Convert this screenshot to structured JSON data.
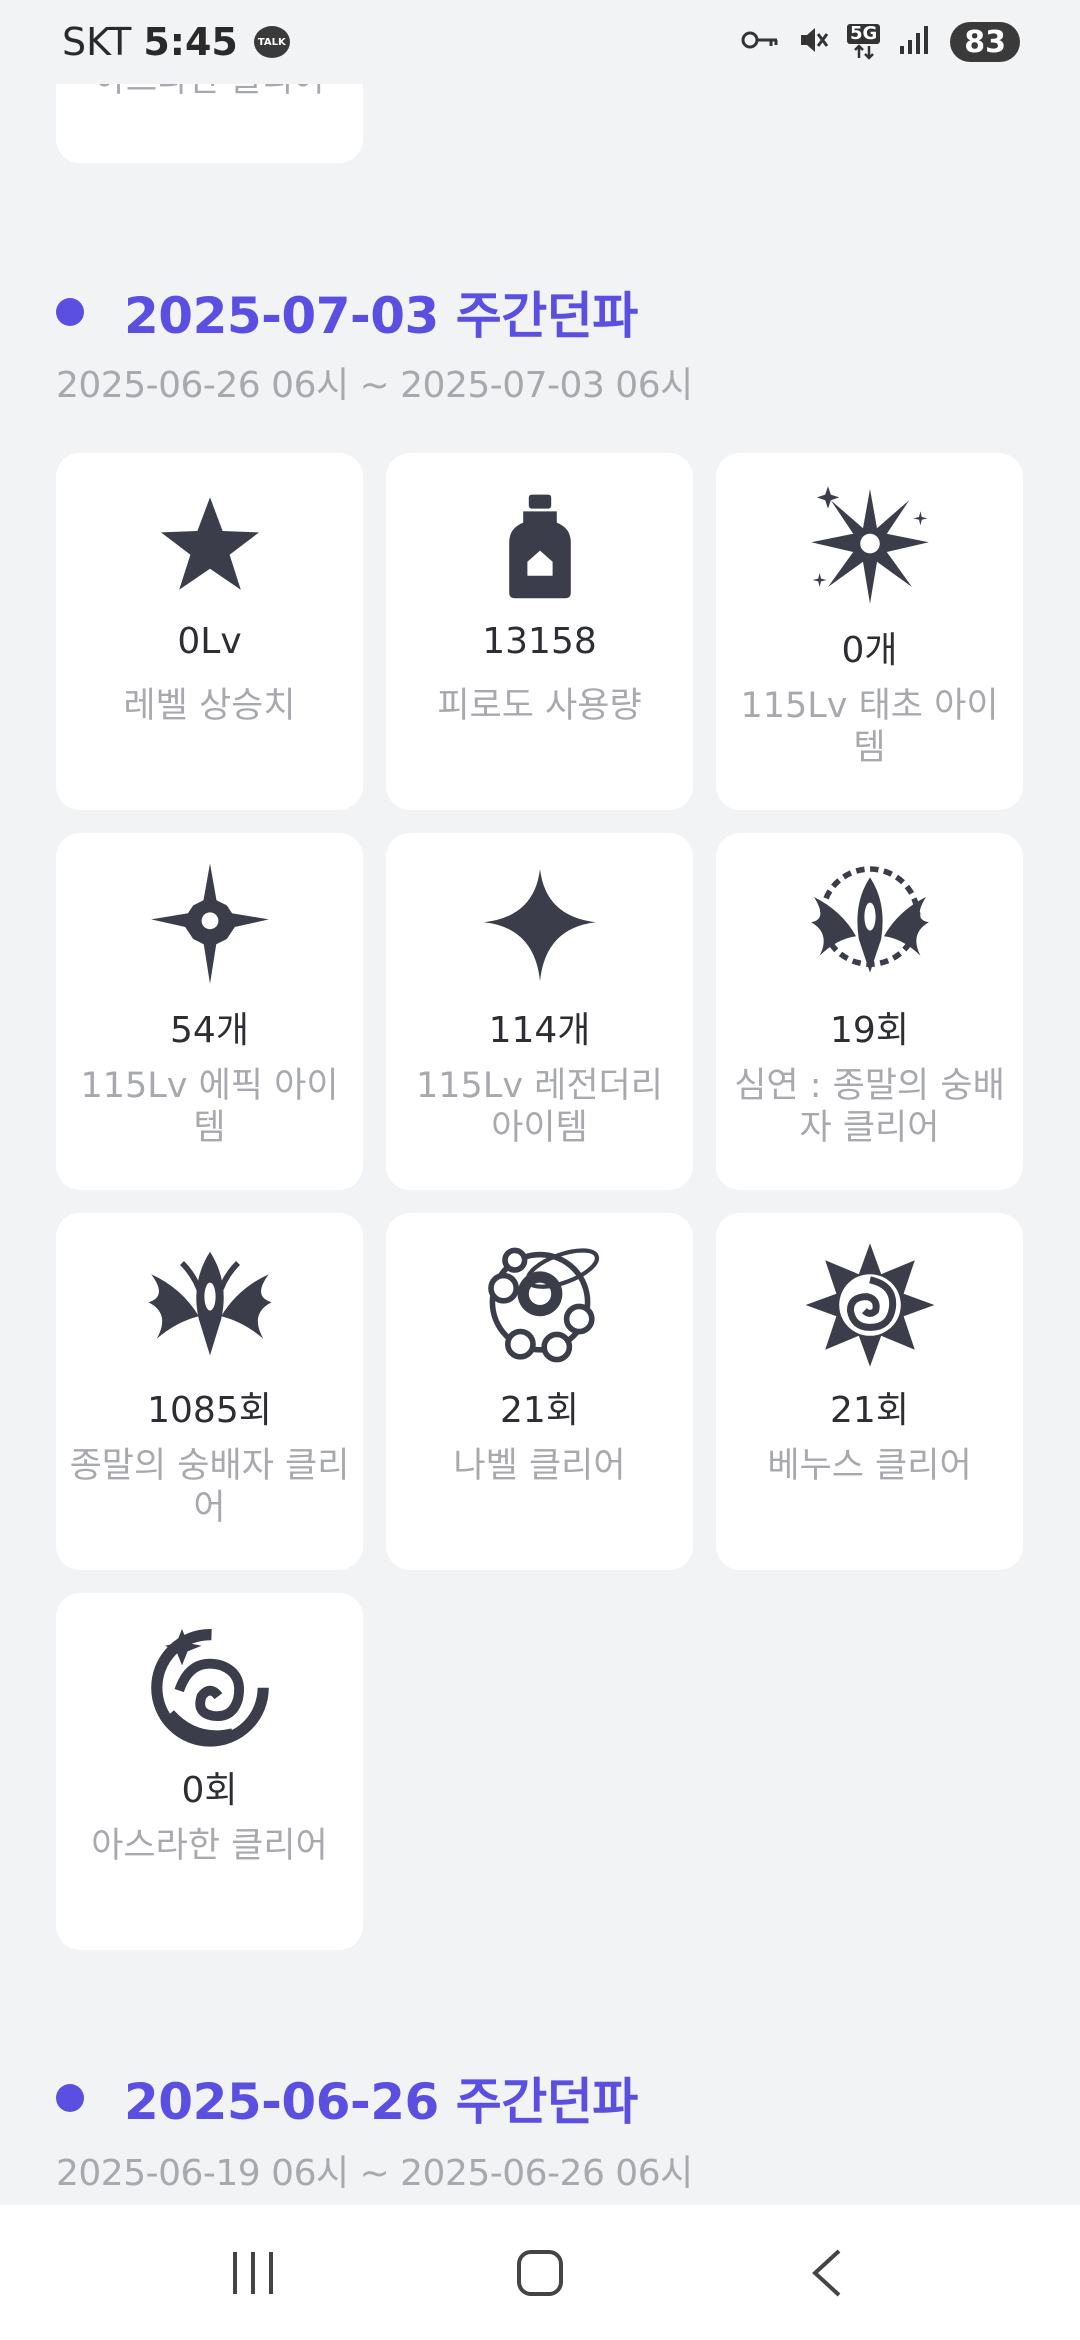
{
  "status_bar": {
    "carrier": "SKT",
    "time": "5:45",
    "talk_badge": "TALK",
    "network": "5G",
    "battery": "83"
  },
  "previous_card": {
    "label": "아스라한 클리어"
  },
  "section1": {
    "title": "2025-07-03 주간던파",
    "range": "2025-06-26 06시 ~ 2025-07-03 06시",
    "cards": [
      {
        "icon": "star-icon",
        "value": "0Lv",
        "label": "레벨 상승치"
      },
      {
        "icon": "potion-bottle-icon",
        "value": "13158",
        "label": "피로도 사용량"
      },
      {
        "icon": "primeval-burst-icon",
        "value": "0개",
        "label": "115Lv 태초 아이템"
      },
      {
        "icon": "epic-star-icon",
        "value": "54개",
        "label": "115Lv 에픽 아이템"
      },
      {
        "icon": "legendary-sparkle-icon",
        "value": "114개",
        "label": "115Lv 레전더리 아이템"
      },
      {
        "icon": "abyss-worshipper-emblem-icon",
        "value": "19회",
        "label": "심연 : 종말의 숭배자 클리어"
      },
      {
        "icon": "worshipper-emblem-icon",
        "value": "1085회",
        "label": "종말의 숭배자 클리어"
      },
      {
        "icon": "nabel-emblem-icon",
        "value": "21회",
        "label": "나벨 클리어"
      },
      {
        "icon": "venus-rose-emblem-icon",
        "value": "21회",
        "label": "베누스 클리어"
      },
      {
        "icon": "asrahan-emblem-icon",
        "value": "0회",
        "label": "아스라한 클리어"
      }
    ]
  },
  "section2": {
    "title": "2025-06-26 주간던파",
    "range": "2025-06-19 06시 ~ 2025-06-26 06시"
  },
  "colors": {
    "accent": "#5a4fe0",
    "background": "#f2f3f5",
    "card": "#ffffff",
    "muted_text": "#a7a9ae",
    "icon": "#3b3d4a"
  }
}
